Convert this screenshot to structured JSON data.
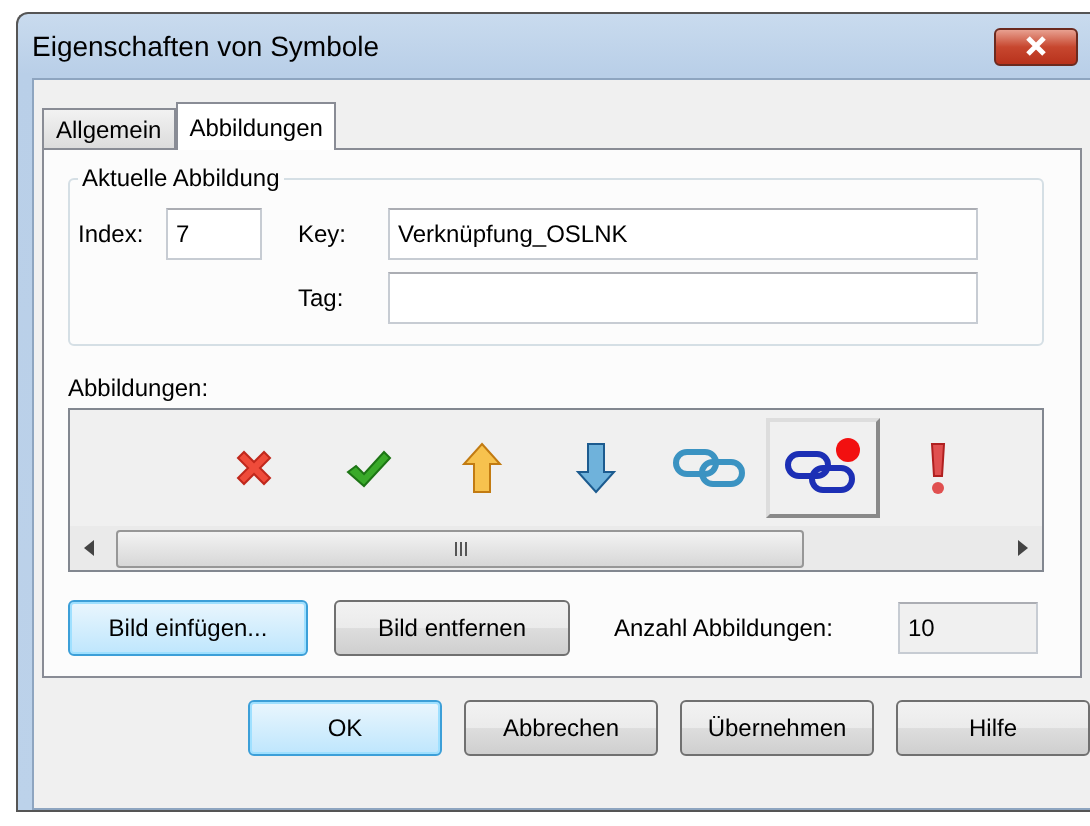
{
  "window": {
    "title": "Eigenschaften von Symbole"
  },
  "tabs": [
    {
      "label": "Allgemein",
      "selected": false
    },
    {
      "label": "Abbildungen",
      "selected": true
    }
  ],
  "current_image": {
    "title": "Aktuelle Abbildung",
    "index_label": "Index:",
    "index_value": "7",
    "key_label": "Key:",
    "key_value": "Verknüpfung_OSLNK",
    "tag_label": "Tag:"
  },
  "images": {
    "label": "Abbildungen:",
    "items": [
      {
        "kind": "cross",
        "selected": false
      },
      {
        "kind": "check",
        "selected": false
      },
      {
        "kind": "arrow-up",
        "selected": false
      },
      {
        "kind": "arrow-down",
        "selected": false
      },
      {
        "kind": "link",
        "selected": false
      },
      {
        "kind": "link-dot",
        "selected": true
      },
      {
        "kind": "exclamation",
        "selected": false
      }
    ]
  },
  "image_buttons": [
    {
      "label": "Bild einfügen...",
      "default": true
    },
    {
      "label": "Bild entfernen",
      "default": false
    }
  ],
  "count": {
    "label": "Anzahl Abbildungen:",
    "value": "10"
  },
  "buttons": [
    {
      "label": "OK",
      "default": true
    },
    {
      "label": "Abbrechen",
      "default": false
    },
    {
      "label": "Übernehmen",
      "default": false
    },
    {
      "label": "Hilfe",
      "default": false
    }
  ]
}
